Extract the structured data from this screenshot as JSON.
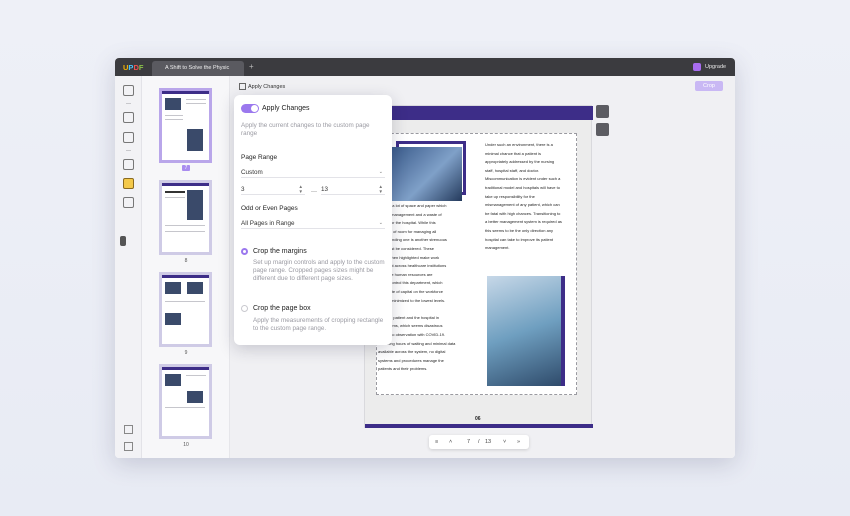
{
  "titlebar": {
    "logo": "UPDF",
    "tab_title": "A Shift to Solve the Physic",
    "new_tab": "+",
    "upgrade_label": "Upgrade"
  },
  "toolbar": {
    "apply_changes_label": "Apply Changes",
    "crop_button_label": "Crop"
  },
  "thumbnails": {
    "items": [
      {
        "label": "7",
        "selected": true
      },
      {
        "label": "8",
        "selected": false
      },
      {
        "label": "9",
        "selected": false
      },
      {
        "label": "10",
        "selected": false
      }
    ]
  },
  "popup": {
    "apply_title": "Apply Changes",
    "apply_desc": "Apply the current changes to the custom page range",
    "page_range_label": "Page Range",
    "page_range_value": "Custom",
    "range_from": "3",
    "range_to": "13",
    "odd_even_label": "Odd or Even Pages",
    "odd_even_value": "All Pages in Range",
    "option1_title": "Crop the margins",
    "option1_desc": "Set up margin controls and apply to the custom page range. Cropped pages sizes might be different due to different page sizes.",
    "option2_title": "Crop the page box",
    "option2_desc": "Apply the measurements of cropping rectangle to the custom page range."
  },
  "document": {
    "page_number": "06",
    "left_column": "equires a lot of space and paper which\npatient management and a waste of\nances for the hospital. While this\ntes a lot of room for managing all\nments finding one is another strenuous\nthat must be considered. These\nlems, when highlighted make work\nagement across healthcare institutions\nult. More human resources are\nred to control this department, which\ne a waste of capital on the workforce\ncan be minimized to the lowest levels.\n\nputs the patient and the hospital in\ne problems, which seems disastrous\nn put into observation with COVID-19.\nWith long hours of waiting and minimal data\navailable across the system, no digital\nsystems and procedures manage the\npatients and their problems.",
    "right_column": "Under such an environment, there is a\nminimal chance that a patient is\nappropriately addressed by the nursing\nstaff, hospital staff, and doctor.\nMiscommunication is evident under such a\ntraditional model and hospitals will have to\ntake up responsibility for the\nmismanagement of any patient, which can\nbe fatal with high chances. Transitioning to\na better management system is required as\nthis seems to be the only direction any\nhospital can take to improve its patient\nmanagement."
  },
  "pager": {
    "current_page": "7",
    "separator": "/",
    "total_pages": "13"
  },
  "colors": {
    "accent": "#9b78ee",
    "brand_dark": "#3d2d88",
    "highlight": "#f4c94a"
  }
}
